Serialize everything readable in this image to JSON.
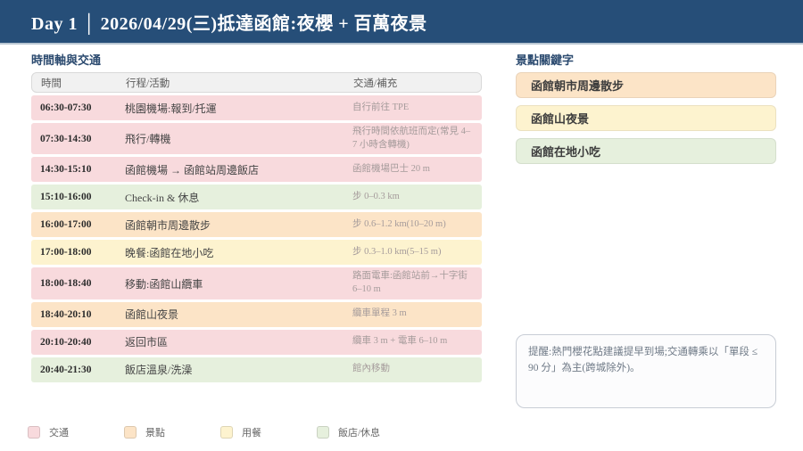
{
  "header": {
    "title": "Day 1 │ 2026/04/29(三)抵達函館:夜櫻 + 百萬夜景"
  },
  "timeline": {
    "section_title": "時間軸與交通",
    "columns": [
      "時間",
      "行程/活動",
      "交通/補充"
    ],
    "rows": [
      {
        "time": "06:30-07:30",
        "activity": "桃園機場:報到/托運",
        "transport": "自行前往 TPE",
        "category": "transport"
      },
      {
        "time": "07:30-14:30",
        "activity": "飛行/轉機",
        "transport": "飛行時間依航班而定(常見 4–7 小時含轉機)",
        "category": "transport"
      },
      {
        "time": "14:30-15:10",
        "activity": "函館機場 → 函館站周邊飯店",
        "transport": "函館機場巴士 20 m",
        "category": "transport"
      },
      {
        "time": "15:10-16:00",
        "activity": "Check-in & 休息",
        "transport": "步 0–0.3 km",
        "category": "hotel"
      },
      {
        "time": "16:00-17:00",
        "activity": "函館朝市周邊散步",
        "transport": "步 0.6–1.2 km(10–20 m)",
        "category": "sight"
      },
      {
        "time": "17:00-18:00",
        "activity": "晚餐:函館在地小吃",
        "transport": "步 0.3–1.0 km(5–15 m)",
        "category": "meal"
      },
      {
        "time": "18:00-18:40",
        "activity": "移動:函館山纜車",
        "transport": "路面電車:函館站前→十字街 6–10 m",
        "category": "transport"
      },
      {
        "time": "18:40-20:10",
        "activity": "函館山夜景",
        "transport": "纜車單程 3 m",
        "category": "sight"
      },
      {
        "time": "20:10-20:40",
        "activity": "返回市區",
        "transport": "纜車 3 m + 電車 6–10 m",
        "category": "transport"
      },
      {
        "time": "20:40-21:30",
        "activity": "飯店溫泉/洗澡",
        "transport": "館內移動",
        "category": "hotel"
      }
    ]
  },
  "keywords": {
    "section_title": "景點關鍵字",
    "items": [
      {
        "label": "函館朝市周邊散步",
        "category": "sight"
      },
      {
        "label": "函館山夜景",
        "category": "meal"
      },
      {
        "label": "函館在地小吃",
        "category": "hotel"
      }
    ]
  },
  "note": {
    "text": "提醒:熱門櫻花點建議提早到場;交通轉乘以「單段 ≤ 90 分」為主(跨城除外)。"
  },
  "legend": {
    "items": [
      {
        "label": "交通",
        "category": "transport",
        "color": "#f8dadd"
      },
      {
        "label": "景點",
        "category": "sight",
        "color": "#fce4c7"
      },
      {
        "label": "用餐",
        "category": "meal",
        "color": "#fdf3cf"
      },
      {
        "label": "飯店/休息",
        "category": "hotel",
        "color": "#e6f0dd"
      }
    ]
  },
  "palette": {
    "header_bg": "#264e78",
    "title_color": "#2b4a6f",
    "transport": "#f8dadd",
    "sight": "#fce4c7",
    "meal": "#fdf3cf",
    "hotel": "#e6f0dd"
  }
}
